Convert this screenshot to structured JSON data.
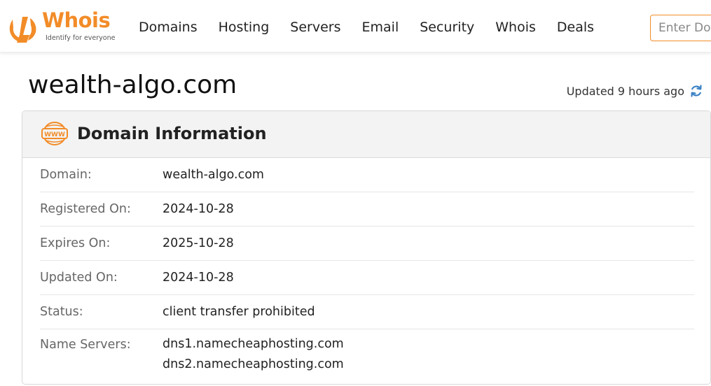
{
  "header": {
    "logo": {
      "word": "Whois",
      "tagline": "Identify for everyone"
    },
    "nav": [
      {
        "label": "Domains"
      },
      {
        "label": "Hosting"
      },
      {
        "label": "Servers"
      },
      {
        "label": "Email"
      },
      {
        "label": "Security"
      },
      {
        "label": "Whois"
      },
      {
        "label": "Deals"
      }
    ],
    "search": {
      "placeholder": "Enter Domain"
    }
  },
  "page": {
    "title": "wealth-algo.com",
    "updated": "Updated 9 hours ago"
  },
  "card": {
    "title": "Domain Information",
    "rows": [
      {
        "label": "Domain:",
        "value": "wealth-algo.com"
      },
      {
        "label": "Registered On:",
        "value": "2024-10-28"
      },
      {
        "label": "Expires On:",
        "value": "2025-10-28"
      },
      {
        "label": "Updated On:",
        "value": "2024-10-28"
      },
      {
        "label": "Status:",
        "value": "client transfer prohibited"
      },
      {
        "label": "Name Servers:",
        "values": [
          "dns1.namecheaphosting.com",
          "dns2.namecheaphosting.com"
        ]
      }
    ]
  },
  "colors": {
    "accent": "#f28c28",
    "refresh": "#3b82c4"
  },
  "icons": {
    "logo": "whois-logo-icon",
    "refresh": "refresh-icon",
    "www": "www-globe-icon"
  }
}
